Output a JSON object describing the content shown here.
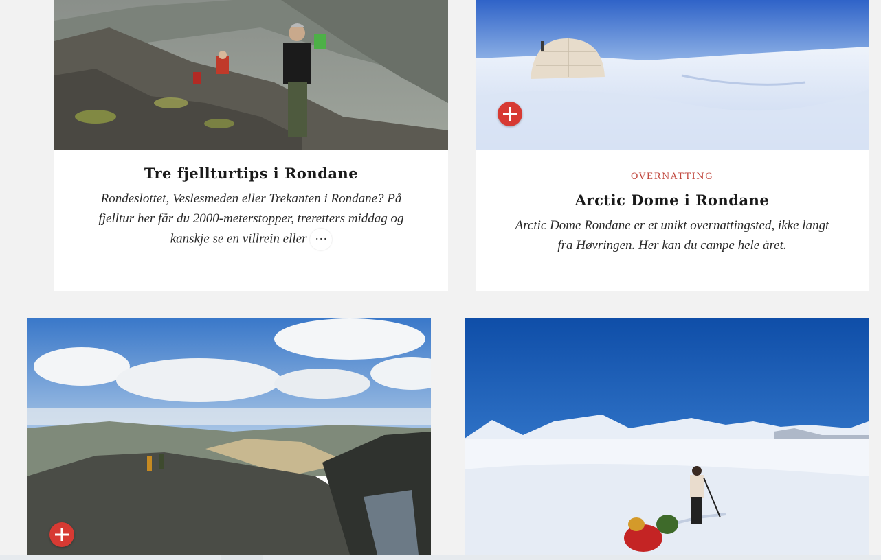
{
  "cards": [
    {
      "title": "Tre fjellturtips i Rondane",
      "category": "",
      "description": "Rondeslottet, Veslesmeden eller Trekanten i Rondane? På fjelltur her får du 2000-meterstopper, treretters middag og kanskje se en villrein eller",
      "more_label": "…",
      "image_icon": "mountain-hikers-photo"
    },
    {
      "title": "Arctic Dome i Rondane",
      "category": "OVERNATTING",
      "description": "Arctic Dome Rondane er et unikt overnattingsted, ikke langt fra Høvringen. Her kan du campe hele året.",
      "image_icon": "snow-dome-tent-photo",
      "badge_icon": "plus-icon"
    },
    {
      "image_icon": "mountain-ridge-clouds-photo",
      "badge_icon": "plus-icon"
    },
    {
      "image_icon": "skier-with-sled-photo"
    }
  ],
  "colors": {
    "background": "#f2f2f2",
    "card": "#ffffff",
    "accent_red": "#d73a33",
    "category_red": "#c0463c"
  }
}
